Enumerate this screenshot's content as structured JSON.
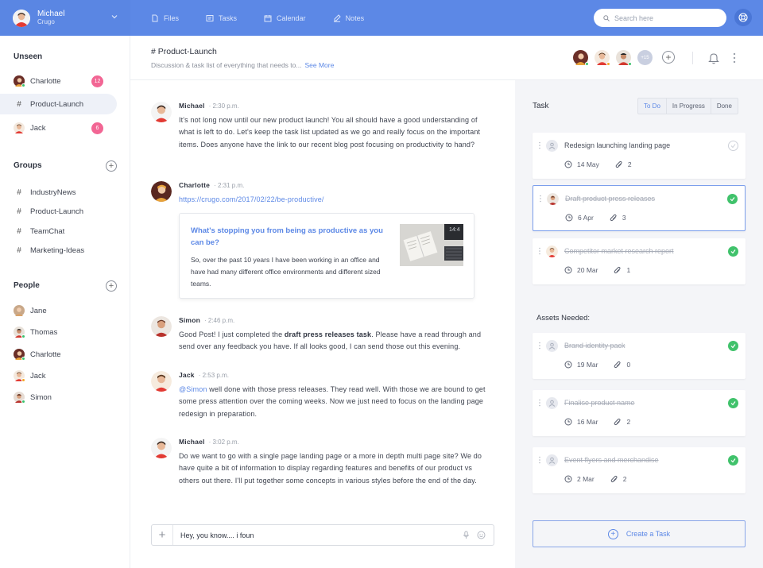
{
  "user": {
    "name": "Michael",
    "org": "Crugo"
  },
  "nav": [
    {
      "label": "Files",
      "icon": "files-icon"
    },
    {
      "label": "Tasks",
      "icon": "tasks-icon"
    },
    {
      "label": "Calendar",
      "icon": "calendar-icon"
    },
    {
      "label": "Notes",
      "icon": "notes-icon"
    }
  ],
  "search": {
    "placeholder": "Search here"
  },
  "sidebar": {
    "unseen_title": "Unseen",
    "unseen": [
      {
        "label": "Charlotte",
        "badge": "12"
      },
      {
        "label": "Product-Launch"
      },
      {
        "label": "Jack",
        "badge": "6"
      }
    ],
    "groups_title": "Groups",
    "groups": [
      "IndustryNews",
      "Product-Launch",
      "TeamChat",
      "Marketing-Ideas"
    ],
    "people_title": "People",
    "people": [
      "Jane",
      "Thomas",
      "Charlotte",
      "Jack",
      "Simon"
    ]
  },
  "channel": {
    "title": "# Product-Launch",
    "desc": "Discussion & task list of everything that needs to...",
    "see_more": "See More",
    "more_count": "+15"
  },
  "messages": [
    {
      "author": "Michael",
      "time": "· 2:30 p.m.",
      "text": "It's not long now until our new product launch! You all should have a good understanding of what is left to do. Let's keep the task list updated as we go and really focus on the important items. Does anyone have the link to our recent blog post focusing on productivity to hand?"
    },
    {
      "author": "Charlotte",
      "time": "· 2:31 p.m.",
      "link": "https://crugo.com/2017/02/22/be-productive/",
      "preview_title": "What's stopping you from being as productive as you can be?",
      "preview_text": "So, over the past 10 years I have been working in an office and have had many different office environments and different sized teams.",
      "preview_clock": "14:4"
    },
    {
      "author": "Simon",
      "time": "· 2:46 p.m.",
      "text_a": "Good Post! I just completed the ",
      "text_bold": "draft press releases task",
      "text_b": ". Please have a read through and send over any feedback you have. If all looks good, I can send those out this evening."
    },
    {
      "author": "Jack",
      "time": "· 2:53 p.m.",
      "mention": "@Simon",
      "text": " well done with those press releases. They read well. With those we are bound to get some press attention over the coming weeks. Now we just need to focus on the landing page redesign in preparation."
    },
    {
      "author": "Michael",
      "time": "· 3:02 p.m.",
      "text": "Do we want to go with a single page landing page or a more in depth multi page site? We do have quite a bit of information to display regarding features and benefits of our product vs others out there. I'll put together some concepts in various styles before the end of the day."
    }
  ],
  "composer": {
    "value": "Hey, you know.... i foun"
  },
  "tasks": {
    "title": "Task",
    "filters": [
      "To Do",
      "In Progress",
      "Done"
    ],
    "items": [
      {
        "title": "Redesign launching landing page",
        "date": "14 May",
        "attachments": "2",
        "done": false
      },
      {
        "title": "Draft product press releases",
        "date": "6 Apr",
        "attachments": "3",
        "done": true
      },
      {
        "title": "Competitor market research report",
        "date": "20 Mar",
        "attachments": "1",
        "done": true
      }
    ],
    "assets_title": "Assets Needed:",
    "assets": [
      {
        "title": "Brand identity pack",
        "date": "19 Mar",
        "attachments": "0",
        "done": true
      },
      {
        "title": "Finalise product name",
        "date": "16 Mar",
        "attachments": "2",
        "done": true
      },
      {
        "title": "Event flyers and merchandise",
        "date": "2 Mar",
        "attachments": "2",
        "done": true
      }
    ],
    "create_label": "Create a Task"
  },
  "colors": {
    "topbar": "#5c88e6",
    "accent": "#5c88e6",
    "badge": "#f26694",
    "done": "#40c26b"
  }
}
